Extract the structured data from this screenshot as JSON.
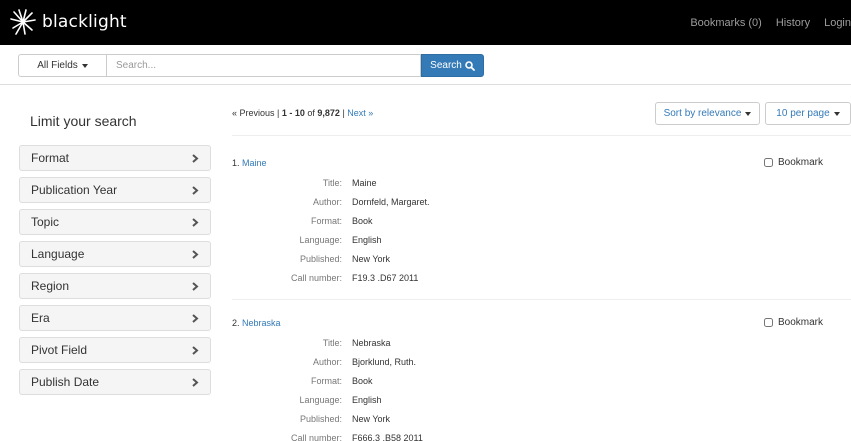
{
  "navbar": {
    "brand": "blacklight",
    "links": [
      "Bookmarks (0)",
      "History",
      "Login"
    ]
  },
  "search": {
    "field_select": "All Fields",
    "placeholder": "Search...",
    "button_label": "Search"
  },
  "sidebar": {
    "title": "Limit your search",
    "facets": [
      "Format",
      "Publication Year",
      "Topic",
      "Language",
      "Region",
      "Era",
      "Pivot Field",
      "Publish Date"
    ]
  },
  "results": {
    "pager": {
      "previous": "« Previous",
      "separator": " | ",
      "range": "1 - 10",
      "of": " of ",
      "total": "9,872",
      "next": "Next »"
    },
    "sort_label": "Sort by relevance",
    "per_page_label": "10 per page",
    "bookmark_label": "Bookmark",
    "field_labels": [
      "Title:",
      "Author:",
      "Format:",
      "Language:",
      "Published:",
      "Call number:"
    ],
    "documents": [
      {
        "index": "1.",
        "title": "Maine",
        "fields": [
          "Maine",
          "Dornfeld, Margaret.",
          "Book",
          "English",
          "New York",
          "F19.3 .D67 2011"
        ]
      },
      {
        "index": "2.",
        "title": "Nebraska",
        "fields": [
          "Nebraska",
          "Bjorklund, Ruth.",
          "Book",
          "English",
          "New York",
          "F666.3 .B58 2011"
        ]
      }
    ]
  },
  "colors": {
    "navbar_bg": "#000000",
    "link": "#337ab7",
    "primary_button": "#337ab7"
  }
}
